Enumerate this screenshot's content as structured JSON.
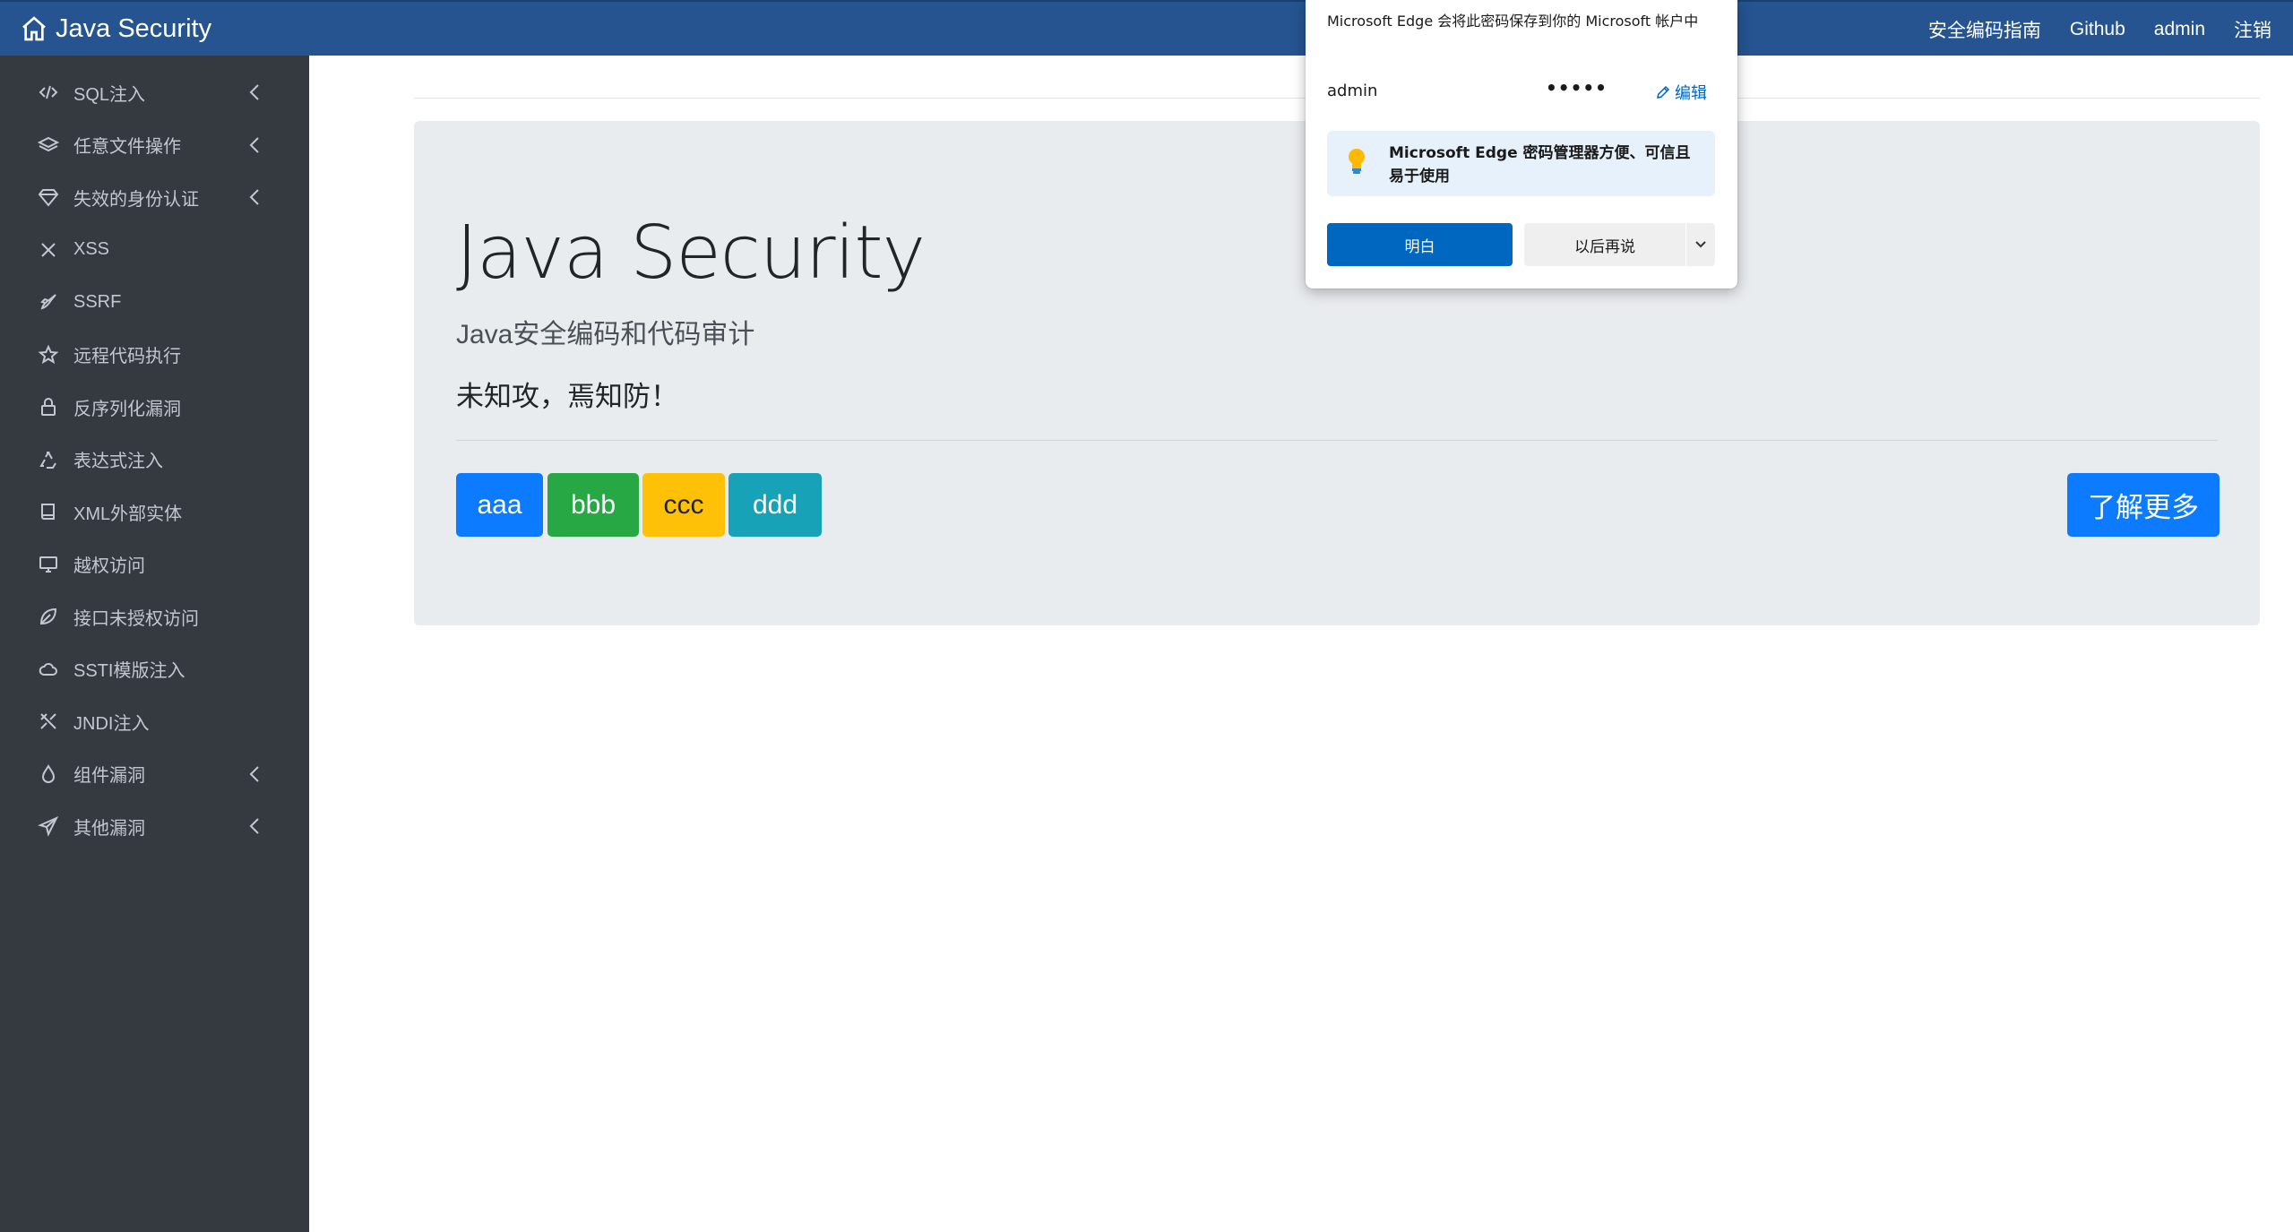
{
  "navbar": {
    "brand": "Java Security",
    "links": [
      "安全编码指南",
      "Github",
      "admin",
      "注销"
    ]
  },
  "sidebar": {
    "items": [
      {
        "label": "SQL注入",
        "icon": "code-icon",
        "has_submenu": true
      },
      {
        "label": "任意文件操作",
        "icon": "layers-icon",
        "has_submenu": true
      },
      {
        "label": "失效的身份认证",
        "icon": "diamond-icon",
        "has_submenu": true
      },
      {
        "label": "XSS",
        "icon": "x-icon",
        "has_submenu": false
      },
      {
        "label": "SSRF",
        "icon": "rocket-icon",
        "has_submenu": false
      },
      {
        "label": "远程代码执行",
        "icon": "star-icon",
        "has_submenu": false
      },
      {
        "label": "反序列化漏洞",
        "icon": "lock-icon",
        "has_submenu": false
      },
      {
        "label": "表达式注入",
        "icon": "recycle-icon",
        "has_submenu": false
      },
      {
        "label": "XML外部实体",
        "icon": "book-icon",
        "has_submenu": false
      },
      {
        "label": "越权访问",
        "icon": "monitor-icon",
        "has_submenu": false
      },
      {
        "label": "接口未授权访问",
        "icon": "leaf-icon",
        "has_submenu": false
      },
      {
        "label": "SSTI模版注入",
        "icon": "cloud-icon",
        "has_submenu": false
      },
      {
        "label": "JNDI注入",
        "icon": "tools-icon",
        "has_submenu": false
      },
      {
        "label": "组件漏洞",
        "icon": "droplet-icon",
        "has_submenu": true
      },
      {
        "label": "其他漏洞",
        "icon": "send-icon",
        "has_submenu": true
      }
    ]
  },
  "jumbotron": {
    "title": "Java Security",
    "subtitle": "Java安全编码和代码审计",
    "motto": "未知攻，焉知防！",
    "buttons": [
      "aaa",
      "bbb",
      "ccc",
      "ddd"
    ],
    "more_button": "了解更多"
  },
  "password_popup": {
    "message": "Microsoft Edge 会将此密码保存到你的 Microsoft 帐户中",
    "username": "admin",
    "password_mask": "•••••",
    "edit_label": "编辑",
    "tip": "Microsoft Edge 密码管理器方便、可信且易于使用",
    "ok_label": "明白",
    "later_label": "以后再说"
  },
  "colors": {
    "navbar_bg": "#255491",
    "sidebar_bg": "#343a40",
    "primary": "#0d7bff",
    "success": "#28a745",
    "warning": "#ffc107",
    "info": "#17a2b8"
  }
}
